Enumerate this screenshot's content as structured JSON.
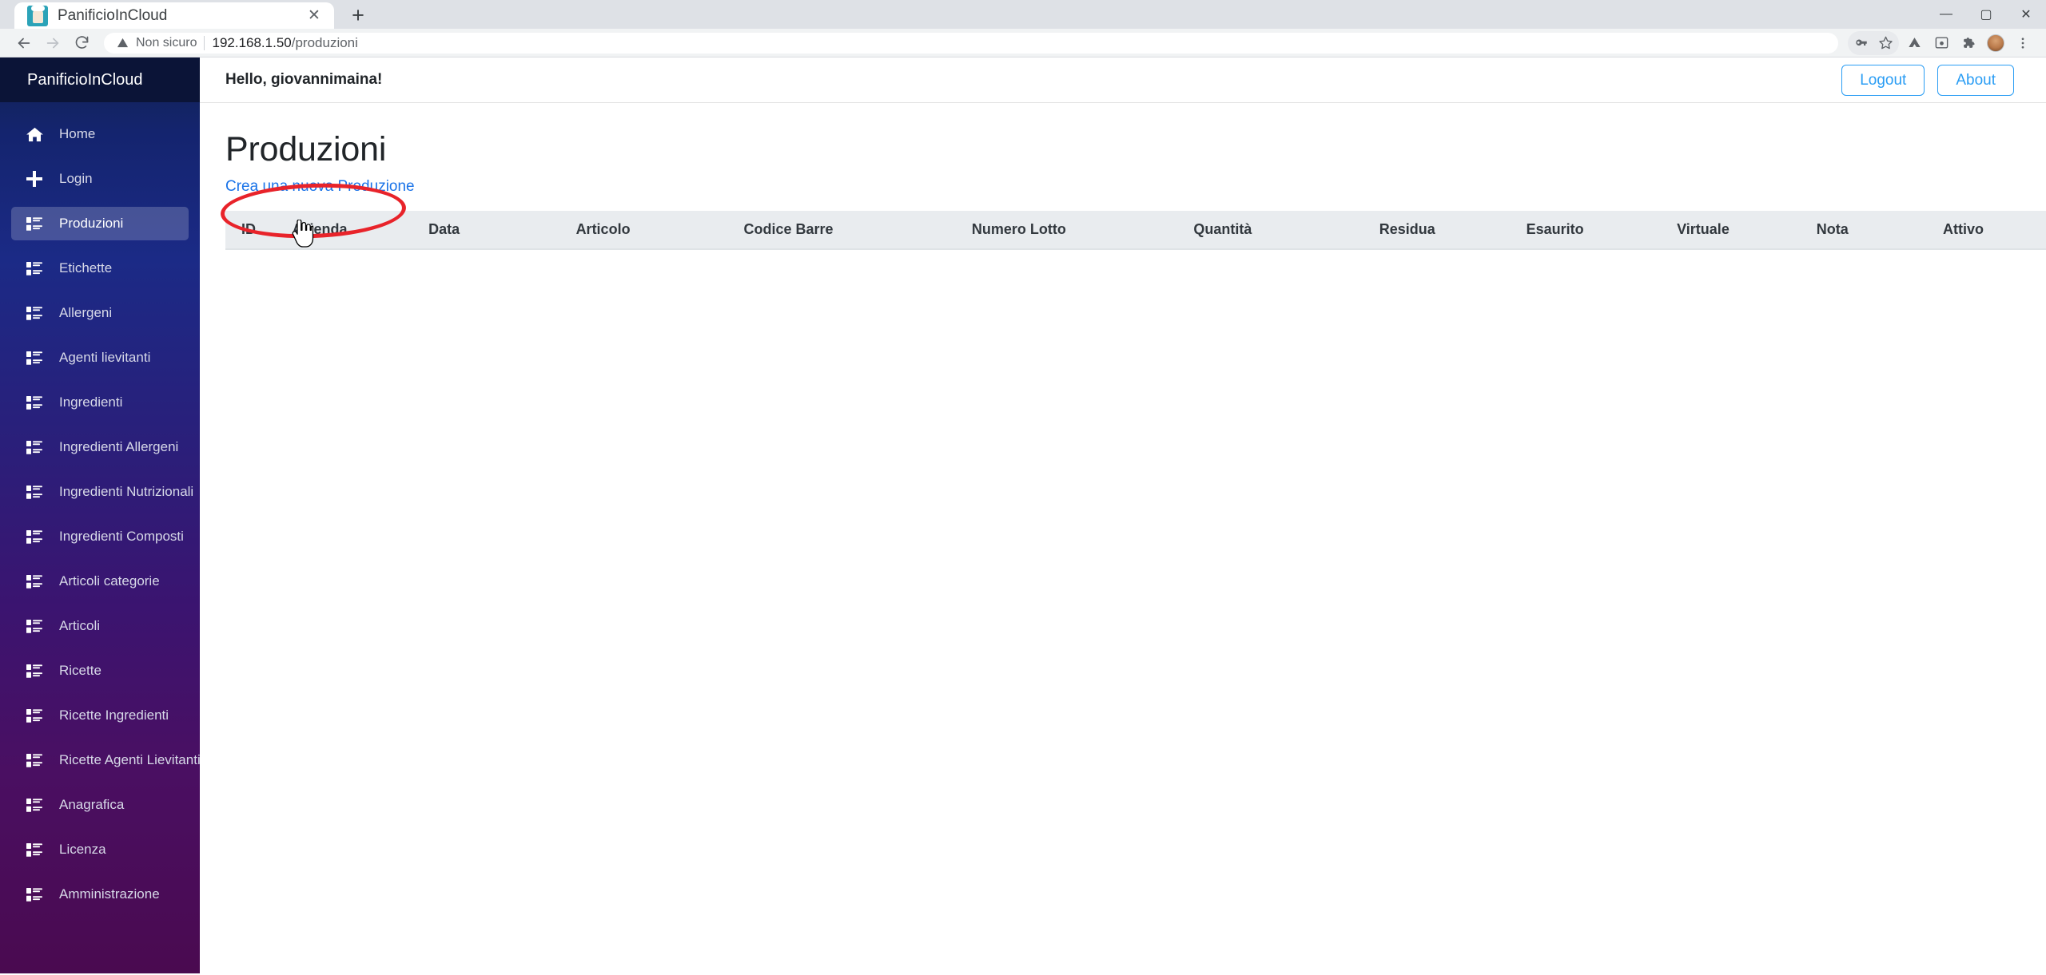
{
  "browser": {
    "tab_title": "PanificioInCloud",
    "tab_favicon": "chef-hat-icon",
    "close_glyph": "✕",
    "newtab_glyph": "+",
    "back_glyph": "←",
    "forward_glyph": "→",
    "reload_glyph": "⟳",
    "security_label": "Non sicuro",
    "url_host": "192.168.1.50",
    "url_path": "/produzioni",
    "minimize_glyph": "—",
    "maximize_glyph": "▢",
    "close_window_glyph": "✕",
    "toolbar_icons": [
      "key-icon",
      "star-icon",
      "drive-icon",
      "chrome-window-icon",
      "extensions-puzzle-icon",
      "profile-avatar-icon",
      "three-dot-menu-icon"
    ]
  },
  "sidebar": {
    "brand": "PanificioInCloud",
    "active_index": 2,
    "items": [
      {
        "label": "Home",
        "icon": "home-icon"
      },
      {
        "label": "Login",
        "icon": "plus-icon"
      },
      {
        "label": "Produzioni",
        "icon": "list-icon"
      },
      {
        "label": "Etichette",
        "icon": "list-icon"
      },
      {
        "label": "Allergeni",
        "icon": "list-icon"
      },
      {
        "label": "Agenti lievitanti",
        "icon": "list-icon"
      },
      {
        "label": "Ingredienti",
        "icon": "list-icon"
      },
      {
        "label": "Ingredienti Allergeni",
        "icon": "list-icon"
      },
      {
        "label": "Ingredienti Nutrizionali",
        "icon": "list-icon"
      },
      {
        "label": "Ingredienti Composti",
        "icon": "list-icon"
      },
      {
        "label": "Articoli categorie",
        "icon": "list-icon"
      },
      {
        "label": "Articoli",
        "icon": "list-icon"
      },
      {
        "label": "Ricette",
        "icon": "list-icon"
      },
      {
        "label": "Ricette Ingredienti",
        "icon": "list-icon"
      },
      {
        "label": "Ricette Agenti Lievitanti",
        "icon": "list-icon"
      },
      {
        "label": "Anagrafica",
        "icon": "list-icon"
      },
      {
        "label": "Licenza",
        "icon": "list-icon"
      },
      {
        "label": "Amministrazione",
        "icon": "list-icon"
      }
    ]
  },
  "topbar": {
    "greeting": "Hello, giovannimaina!",
    "logout_label": "Logout",
    "about_label": "About"
  },
  "main": {
    "page_title": "Produzioni",
    "create_link": "Crea una nuova Produzione",
    "table": {
      "headers": [
        "ID",
        "Azienda",
        "Data",
        "Articolo",
        "Codice Barre",
        "Numero Lotto",
        "Quantità",
        "Residua",
        "Esaurito",
        "Virtuale",
        "Nota",
        "Attivo"
      ],
      "rows": []
    }
  },
  "annotation": {
    "shape": "red-ellipse-highlight",
    "color": "#e8232a"
  },
  "colors": {
    "accent_link": "#1a73e8",
    "button_outline": "#2a9df4",
    "sidebar_top": "#112250",
    "sidebar_bottom": "#4a0a50",
    "table_header_bg": "#e9ecef"
  }
}
